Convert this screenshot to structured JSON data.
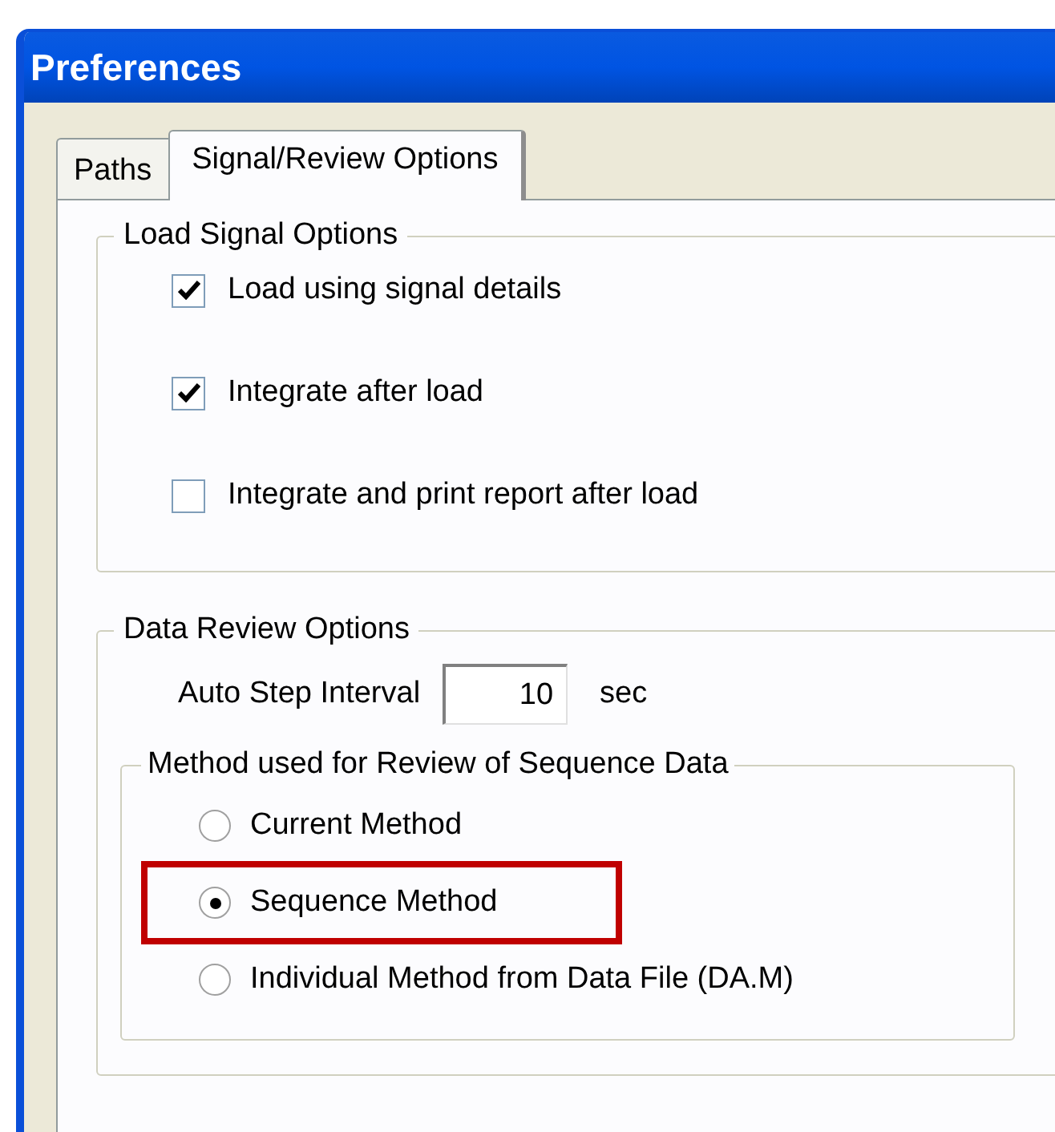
{
  "window": {
    "title": "Preferences"
  },
  "tabs": [
    {
      "label": "Paths",
      "selected": false
    },
    {
      "label": "Signal/Review Options",
      "selected": true
    }
  ],
  "load_signal_options": {
    "title": "Load Signal Options",
    "options": [
      {
        "label": "Load using signal details",
        "checked": true
      },
      {
        "label": "Integrate after load",
        "checked": true
      },
      {
        "label": "Integrate and print report after load",
        "checked": false
      }
    ]
  },
  "data_review_options": {
    "title": "Data Review Options",
    "auto_step": {
      "label": "Auto Step Interval",
      "value": "10",
      "unit": "sec"
    },
    "method_group": {
      "title": "Method used for Review of Sequence Data",
      "options": [
        {
          "label": "Current Method",
          "selected": false,
          "highlighted": false
        },
        {
          "label": "Sequence Method",
          "selected": true,
          "highlighted": true
        },
        {
          "label": "Individual Method from Data File (DA.M)",
          "selected": false,
          "highlighted": false
        }
      ]
    }
  }
}
